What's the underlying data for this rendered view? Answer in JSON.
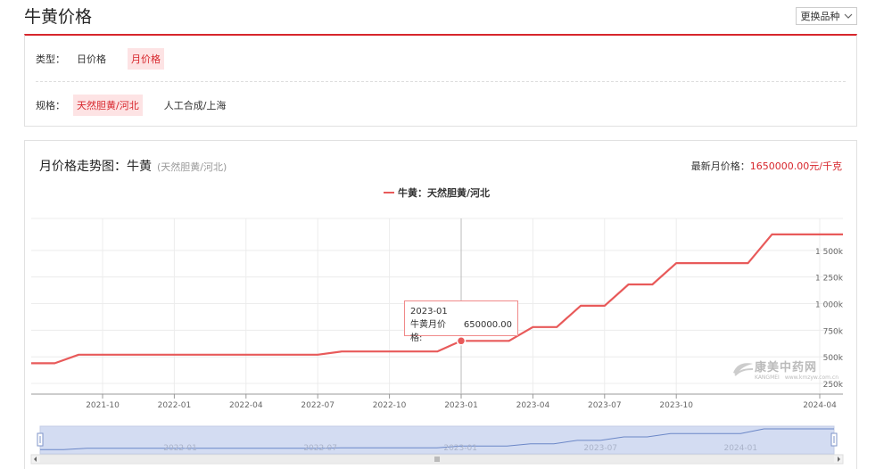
{
  "page": {
    "title": "牛黄价格",
    "switch_label": "更换品种"
  },
  "filters": {
    "type_label": "类型：",
    "type_options": [
      "日价格",
      "月价格"
    ],
    "spec_label": "规格：",
    "spec_options": [
      "天然胆黄/河北",
      "人工合成/上海"
    ]
  },
  "chart_header": {
    "title": "月价格走势图：牛黄",
    "subtitle": "(天然胆黄/河北)",
    "latest_label": "最新月价格：",
    "latest_value": "1650000.00元/千克"
  },
  "tooltip": {
    "date": "2023-01",
    "label": "牛黄月价格:",
    "value": "650000.00"
  },
  "watermark": {
    "name": "康美中药网",
    "sub": "KANGMEI",
    "url": "www.kmzyw.com.cn"
  },
  "colors": {
    "line": "#e85a5a",
    "accent": "#d7262c",
    "zoom_fill": "#d3dcf2",
    "zoom_line": "#6b87c7"
  },
  "chart_data": {
    "type": "line",
    "legend": "牛黄：天然胆黄/河北",
    "legend_position": "top-center",
    "grid": true,
    "x_ticks": [
      "2021-10",
      "2022-01",
      "2022-04",
      "2022-07",
      "2022-10",
      "2023-01",
      "2023-04",
      "2023-07",
      "2023-10",
      "2024-04"
    ],
    "y_ticks": [
      {
        "v": 250000,
        "label": "250k"
      },
      {
        "v": 500000,
        "label": "500k"
      },
      {
        "v": 750000,
        "label": "750k"
      },
      {
        "v": 1000000,
        "label": "1 000k"
      },
      {
        "v": 1250000,
        "label": "1 250k"
      },
      {
        "v": 1500000,
        "label": "1 500k"
      }
    ],
    "ylim": [
      150000,
      1800000
    ],
    "series": [
      {
        "name": "牛黄：天然胆黄/河北",
        "points": [
          [
            "2021-07",
            440000
          ],
          [
            "2021-08",
            440000
          ],
          [
            "2021-09",
            520000
          ],
          [
            "2021-10",
            520000
          ],
          [
            "2021-11",
            520000
          ],
          [
            "2021-12",
            520000
          ],
          [
            "2022-01",
            520000
          ],
          [
            "2022-02",
            520000
          ],
          [
            "2022-03",
            520000
          ],
          [
            "2022-04",
            520000
          ],
          [
            "2022-05",
            520000
          ],
          [
            "2022-06",
            520000
          ],
          [
            "2022-07",
            520000
          ],
          [
            "2022-08",
            550000
          ],
          [
            "2022-09",
            550000
          ],
          [
            "2022-10",
            550000
          ],
          [
            "2022-11",
            550000
          ],
          [
            "2022-12",
            550000
          ],
          [
            "2023-01",
            650000
          ],
          [
            "2023-02",
            650000
          ],
          [
            "2023-03",
            650000
          ],
          [
            "2023-04",
            780000
          ],
          [
            "2023-05",
            780000
          ],
          [
            "2023-06",
            980000
          ],
          [
            "2023-07",
            980000
          ],
          [
            "2023-08",
            1180000
          ],
          [
            "2023-09",
            1180000
          ],
          [
            "2023-10",
            1380000
          ],
          [
            "2023-11",
            1380000
          ],
          [
            "2023-12",
            1380000
          ],
          [
            "2024-01",
            1380000
          ],
          [
            "2024-02",
            1650000
          ],
          [
            "2024-03",
            1650000
          ],
          [
            "2024-04",
            1650000
          ],
          [
            "2024-05",
            1650000
          ]
        ]
      }
    ],
    "zoom_ticks": [
      "2022-01",
      "2022-07",
      "2023-01",
      "2023-07",
      "2024-01"
    ],
    "zoom_range": [
      0,
      1
    ]
  }
}
